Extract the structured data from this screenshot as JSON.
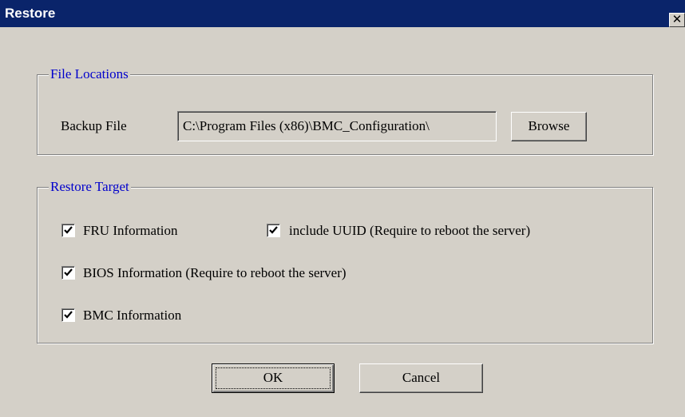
{
  "window": {
    "title": "Restore",
    "close_glyph": "✕"
  },
  "file_locations": {
    "legend": "File Locations",
    "backup_label": "Backup File",
    "backup_value": "C:\\Program Files (x86)\\BMC_Configuration\\",
    "browse_label": "Browse"
  },
  "restore_target": {
    "legend": "Restore Target",
    "options": [
      {
        "label": "FRU Information",
        "checked": true
      },
      {
        "label": "include UUID (Require to reboot the server)",
        "checked": true
      },
      {
        "label": "BIOS Information (Require to reboot the server)",
        "checked": true
      },
      {
        "label": "BMC Information",
        "checked": true
      }
    ]
  },
  "buttons": {
    "ok_label": "OK",
    "cancel_label": "Cancel"
  },
  "colors": {
    "title_bar": "#0a246a",
    "dialog_face": "#d4d0c8",
    "legend_text": "#0000cc"
  },
  "icons": {
    "close": "close-icon",
    "check": "checkmark-icon"
  }
}
